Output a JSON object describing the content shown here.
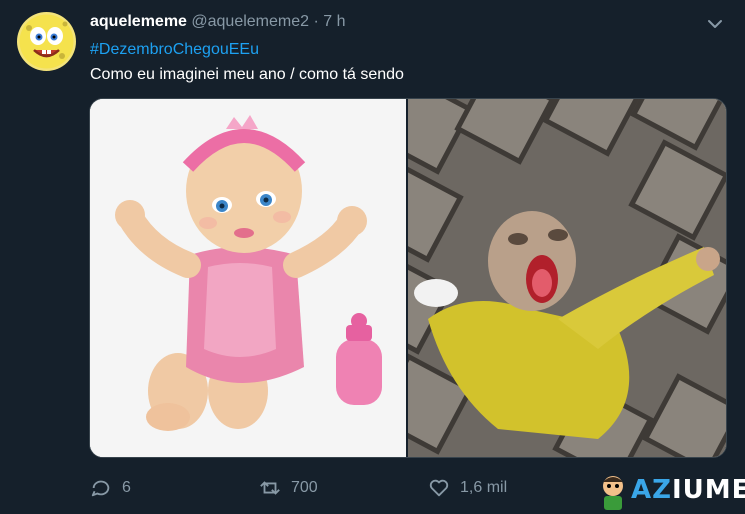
{
  "tweet": {
    "display_name": "aquelememe",
    "handle": "@aquelememe2",
    "separator": "·",
    "time": "7 h",
    "hashtag": "#DezembroChegouEEu",
    "text": "Como eu imaginei meu ano / como tá sendo"
  },
  "media": {
    "left_image": "clean pink baby doll",
    "right_image": "dirty broken doll on pavement"
  },
  "actions": {
    "replies": "6",
    "retweets": "700",
    "likes": "1,6 mil"
  },
  "watermark": {
    "brand_prefix": "AZ",
    "brand_rest": "IUME"
  },
  "colors": {
    "background": "#15202b",
    "link": "#1da1f2",
    "muted": "#8899a6",
    "border": "#38444d"
  }
}
